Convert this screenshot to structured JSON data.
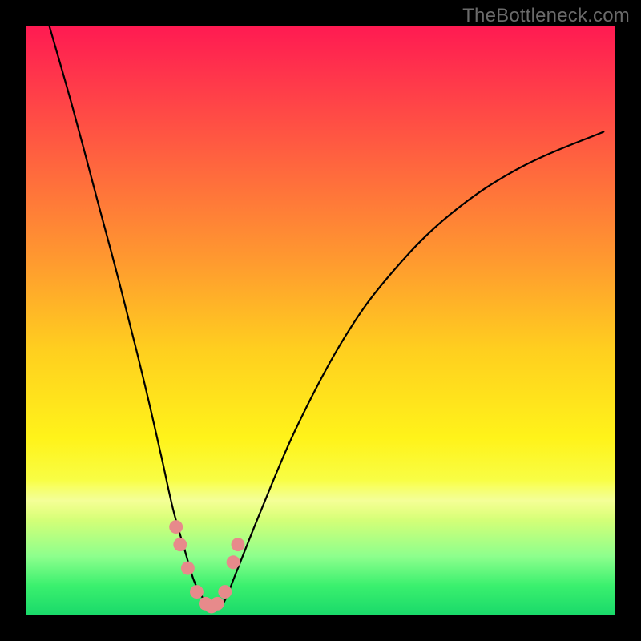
{
  "watermark": "TheBottleneck.com",
  "colors": {
    "frame": "#000000",
    "curve_stroke": "#000000",
    "marker_fill": "#e78a8b",
    "gradient_stops": [
      "#ff1a52",
      "#ff3a4a",
      "#ff6a3d",
      "#ff9a2f",
      "#ffcf1f",
      "#fff31a",
      "#f7ff4a",
      "#d2ff78",
      "#8dff8d",
      "#3af06e",
      "#19d96a"
    ]
  },
  "chart_data": {
    "type": "line",
    "title": "",
    "xlabel": "",
    "ylabel": "",
    "xlim": [
      0,
      100
    ],
    "ylim": [
      0,
      100
    ],
    "grid": false,
    "legend_position": "none",
    "annotations": [
      "TheBottleneck.com"
    ],
    "notes": "V-shaped bottleneck curve over a heat-map gradient. No tick labels are visible; x and y are normalized 0–100. Lower y = better (near the bottom/green). Markers cluster near the trough.",
    "series": [
      {
        "name": "bottleneck-curve",
        "x": [
          4,
          8,
          12,
          16,
          20,
          23,
          25,
          27,
          28.5,
          30,
          31,
          32,
          33,
          34,
          36,
          40,
          46,
          54,
          62,
          72,
          84,
          98
        ],
        "y": [
          100,
          86,
          71,
          56,
          40,
          27,
          18,
          11,
          6,
          3,
          1.5,
          1,
          1.5,
          3,
          8,
          18,
          32,
          47,
          58,
          68,
          76,
          82
        ]
      }
    ],
    "markers": {
      "name": "highlight-points",
      "x": [
        25.5,
        26.2,
        27.5,
        29.0,
        30.5,
        31.5,
        32.5,
        33.8,
        35.2,
        36.0
      ],
      "y": [
        15,
        12,
        8,
        4,
        2,
        1.5,
        2,
        4,
        9,
        12
      ],
      "color": "#e78a8b",
      "radius_pct": 1.15
    }
  }
}
